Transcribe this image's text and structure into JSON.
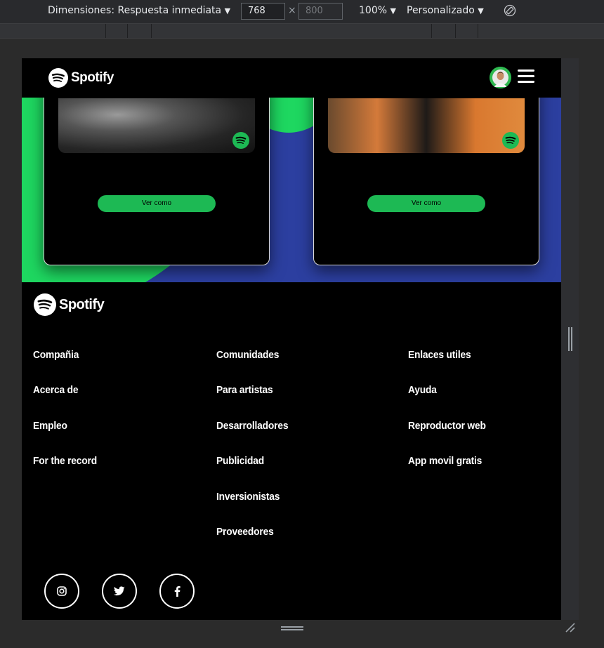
{
  "devtools": {
    "dimensions_label": "Dimensiones: Respuesta inmediata",
    "width_value": "768",
    "times": "×",
    "height_value": "800",
    "zoom": "100%",
    "throttle": "Personalizado",
    "dropdown_glyph": "▼"
  },
  "navbar": {
    "logo_text": "Spotify"
  },
  "cards": [
    {
      "button_label": "Ver como"
    },
    {
      "button_label": "Ver como"
    }
  ],
  "footer": {
    "logo_text": "Spotify",
    "columns": [
      {
        "links": [
          "Compañia",
          "Acerca de",
          "Empleo",
          "For the record"
        ]
      },
      {
        "links": [
          "Comunidades",
          "Para artistas",
          "Desarrolladores",
          "Publicidad",
          "Inversionistas",
          "Proveedores"
        ]
      },
      {
        "links": [
          "Enlaces utiles",
          "Ayuda",
          "Reproductor web",
          "App movil gratis"
        ]
      }
    ],
    "social": [
      "instagram-icon",
      "twitter-icon",
      "facebook-icon"
    ]
  },
  "colors": {
    "brand_green": "#1db954",
    "hero_blue": "#2c3fa0",
    "blob_green": "#1ed760"
  }
}
